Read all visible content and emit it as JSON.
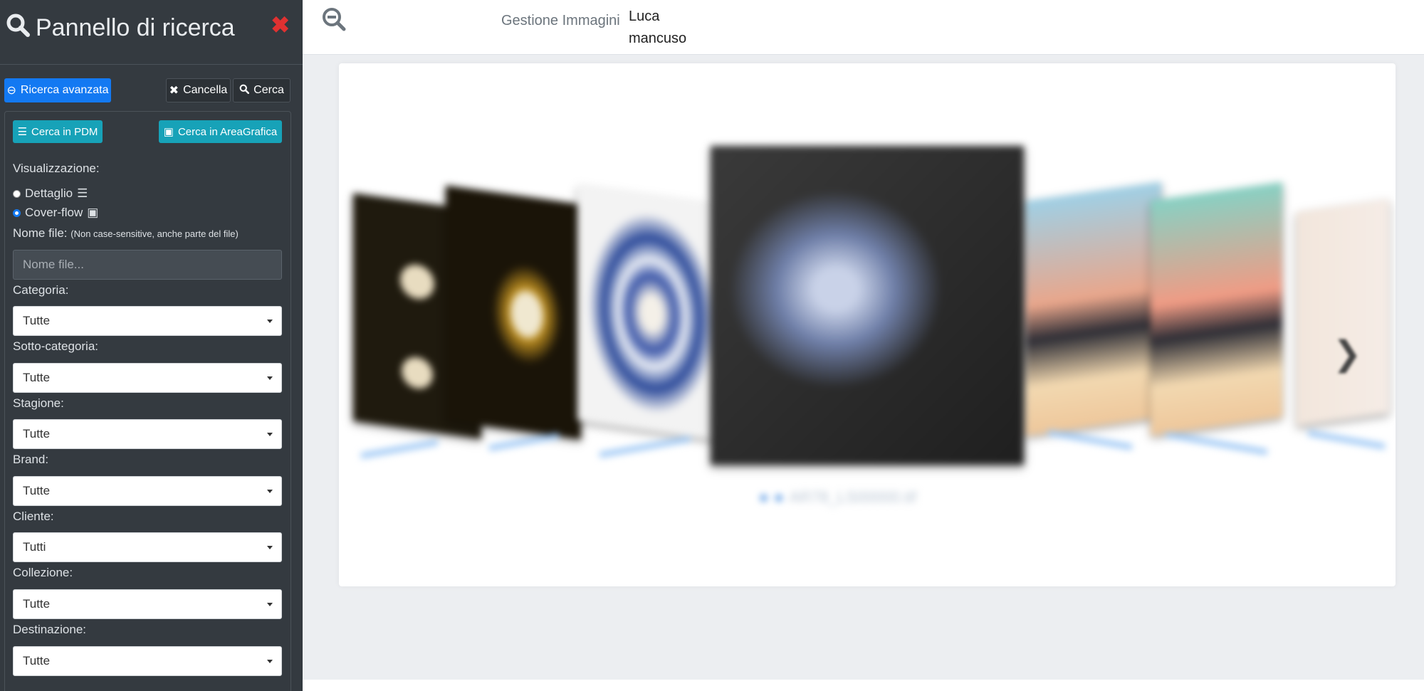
{
  "sidebar": {
    "title": "Pannello di ricerca",
    "close_icon": "close-icon",
    "buttons": {
      "advanced": "Ricerca avanzata",
      "cancel": "Cancella",
      "search": "Cerca",
      "search_pdm": "Cerca in PDM",
      "search_area": "Cerca in AreaGrafica"
    },
    "view_label": "Visualizzazione:",
    "view_options": [
      {
        "label": "Dettaglio",
        "icon": "list-icon",
        "selected": false
      },
      {
        "label": "Cover-flow",
        "icon": "images-icon",
        "selected": true
      }
    ],
    "filename_label": "Nome file:",
    "filename_hint": "(Non case-sensitive, anche parte del file)",
    "filename_placeholder": "Nome file...",
    "filters": [
      {
        "label": "Categoria:",
        "value": "Tutte"
      },
      {
        "label": "Sotto-categoria:",
        "value": "Tutte"
      },
      {
        "label": "Stagione:",
        "value": "Tutte"
      },
      {
        "label": "Brand:",
        "value": "Tutte"
      },
      {
        "label": "Cliente:",
        "value": "Tutti"
      },
      {
        "label": "Collezione:",
        "value": "Tutte"
      },
      {
        "label": "Destinazione:",
        "value": "Tutte"
      }
    ]
  },
  "topbar": {
    "app_name": "Gestione Immagini",
    "user_first": "Luca",
    "user_last": "mancuso"
  },
  "coverflow": {
    "center_caption": "AR78_LS00000.tif"
  },
  "colors": {
    "sidebar_bg": "#343a40",
    "primary": "#1379f2",
    "teal": "#17a2b8",
    "danger": "#e03131"
  }
}
